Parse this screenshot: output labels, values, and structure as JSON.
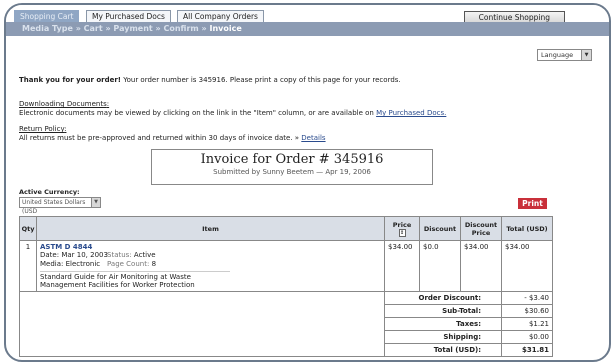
{
  "tabs": [
    {
      "label": "Shopping Cart",
      "active": true
    },
    {
      "label": "My Purchased Docs",
      "active": false
    },
    {
      "label": "All Company Orders",
      "active": false
    }
  ],
  "continue_label": "Continue Shopping",
  "breadcrumb": {
    "prefix": "Media Type » Cart » Payment » Confirm »",
    "current": "Invoice"
  },
  "language": {
    "selected": "Language"
  },
  "thanks": {
    "bold": "Thank you for your order!",
    "text": "Your order number is 345916.  Please print a copy of this page for your records."
  },
  "downloading": {
    "heading": "Downloading Documents",
    "text": "Electronic documents may be viewed by clicking on the link in the \"Item\" column, or are available on",
    "link": "My Purchased Docs."
  },
  "return_policy": {
    "heading": "Return Policy",
    "text": "All returns must be pre-approved and returned within 30 days of invoice date.  »",
    "link": "Details"
  },
  "invoice": {
    "title": "Invoice for Order # 345916",
    "subtitle": "Submitted by Sunny Beetem — Apr 19, 2006"
  },
  "currency": {
    "label": "Active Currency:",
    "selected": "United States Dollars (USD"
  },
  "print_label": "Print",
  "table": {
    "headers": {
      "qty": "Qty",
      "item": "Item",
      "price": "Price",
      "sort_glyph": "↕",
      "discount": "Discount",
      "discount_price": "Discount Price",
      "total": "Total (USD)"
    },
    "rows": [
      {
        "qty": "1",
        "title": "ASTM D 4844",
        "date_label": "Date:",
        "date": "Mar 10, 2003",
        "status_label": "Status:",
        "status": "Active",
        "media_label": "Media:",
        "media": "Electronic",
        "pages_label": "Page Count:",
        "pages": "8",
        "description": "Standard Guide for Air Monitoring at Waste Management Facilities for Worker Protection",
        "price": "$34.00",
        "discount": "$0.0",
        "discount_price": "$34.00",
        "total": "$34.00"
      }
    ],
    "summary": [
      {
        "label": "Order Discount:",
        "value": "- $3.40"
      },
      {
        "label": "Sub-Total:",
        "value": "$30.60"
      },
      {
        "label": "Taxes:",
        "value": "$1.21"
      },
      {
        "label": "Shipping:",
        "value": "$0.00"
      },
      {
        "label": "Total (USD):",
        "value": "$31.81"
      }
    ]
  }
}
